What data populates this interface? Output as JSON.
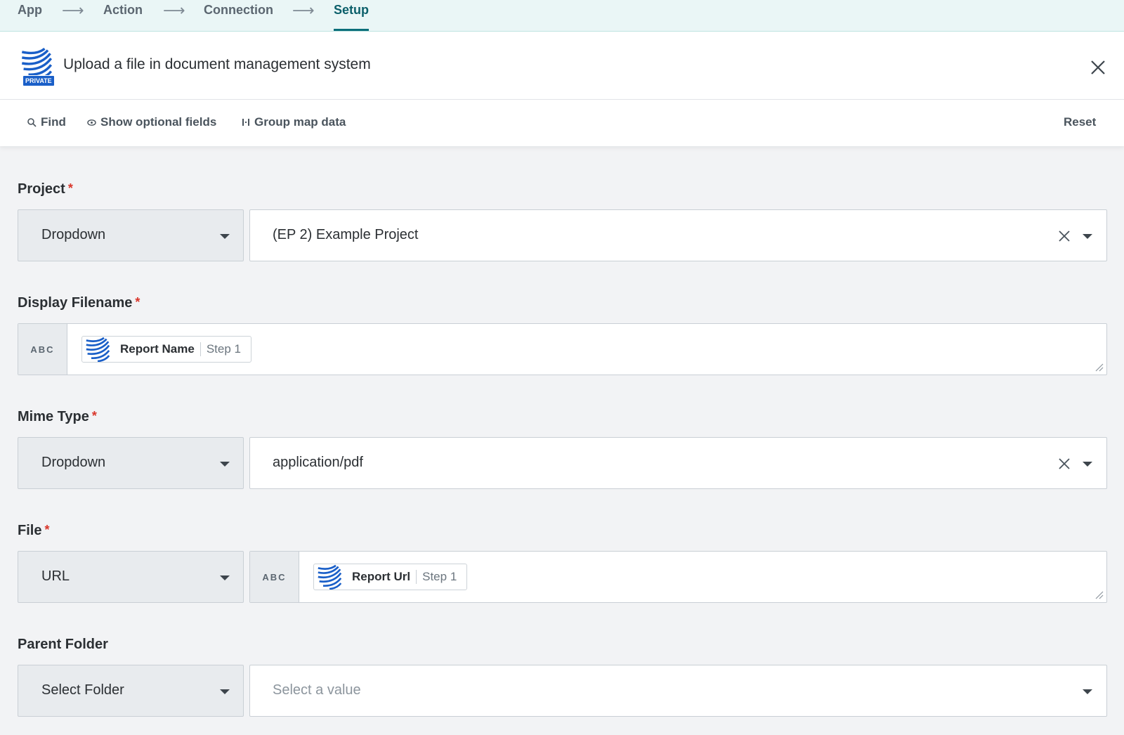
{
  "steps": {
    "items": [
      "App",
      "Action",
      "Connection",
      "Setup"
    ],
    "arrow": "⟶",
    "active": "Setup"
  },
  "header": {
    "title": "Upload a file in document management system",
    "badge": "PRIVATE",
    "logo_icon": "wave-stripes-logo-icon",
    "close_icon": "close-icon"
  },
  "toolbar": {
    "find": "Find",
    "show_optional": "Show optional fields",
    "group_map": "Group map data",
    "reset": "Reset"
  },
  "fields": {
    "project": {
      "label": "Project",
      "required": "*",
      "mode": "Dropdown",
      "value": "(EP 2) Example Project"
    },
    "display_filename": {
      "label": "Display Filename",
      "required": "*",
      "type_tag": "ABC",
      "pill_name": "Report Name",
      "pill_step": "Step 1"
    },
    "mime_type": {
      "label": "Mime Type",
      "required": "*",
      "mode": "Dropdown",
      "value": "application/pdf"
    },
    "file": {
      "label": "File",
      "required": "*",
      "mode": "URL",
      "type_tag": "ABC",
      "pill_name": "Report Url",
      "pill_step": "Step 1"
    },
    "parent_folder": {
      "label": "Parent Folder",
      "mode": "Select Folder",
      "placeholder": "Select a value"
    }
  },
  "colors": {
    "accent": "#0b6f7a",
    "required": "#d9362b",
    "brand_blue": "#1a5fc8"
  }
}
